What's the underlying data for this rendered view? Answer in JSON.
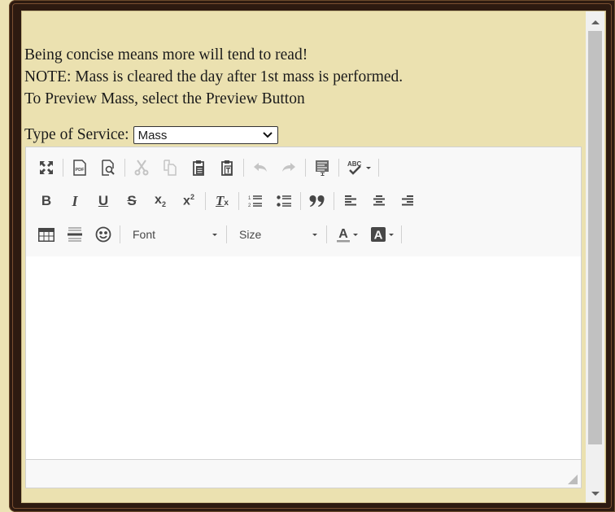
{
  "messages": [
    "Being concise means more will tend to read!",
    "NOTE: Mass is cleared the day after 1st mass is performed.",
    "To Preview Mass, select the Preview Button"
  ],
  "service": {
    "label": "Type of Service:",
    "selected": "Mass"
  },
  "toolbar": {
    "row1": [
      {
        "name": "maximize",
        "icon": "maximize-icon",
        "enabled": true
      },
      {
        "name": "export-pdf",
        "icon": "pdf-icon",
        "enabled": true
      },
      {
        "name": "preview",
        "icon": "preview-icon",
        "enabled": true
      },
      {
        "name": "cut",
        "icon": "scissors-icon",
        "enabled": false
      },
      {
        "name": "copy",
        "icon": "copy-icon",
        "enabled": false
      },
      {
        "name": "paste",
        "icon": "paste-icon",
        "enabled": true
      },
      {
        "name": "paste-text",
        "icon": "paste-text-icon",
        "enabled": true
      },
      {
        "name": "undo",
        "icon": "undo-icon",
        "enabled": false
      },
      {
        "name": "redo",
        "icon": "redo-icon",
        "enabled": false
      },
      {
        "name": "form-field",
        "icon": "text-field-icon",
        "enabled": true
      },
      {
        "name": "spell-check",
        "icon": "spellcheck-icon",
        "enabled": true
      }
    ],
    "row2": [
      {
        "name": "bold",
        "icon": "bold-icon",
        "enabled": true
      },
      {
        "name": "italic",
        "icon": "italic-icon",
        "enabled": true
      },
      {
        "name": "underline",
        "icon": "underline-icon",
        "enabled": true
      },
      {
        "name": "strikethrough",
        "icon": "strikethrough-icon",
        "enabled": true
      },
      {
        "name": "subscript",
        "icon": "subscript-icon",
        "enabled": true
      },
      {
        "name": "superscript",
        "icon": "superscript-icon",
        "enabled": true
      },
      {
        "name": "remove-format",
        "icon": "clear-format-icon",
        "enabled": true
      },
      {
        "name": "numbered-list",
        "icon": "numbered-list-icon",
        "enabled": true
      },
      {
        "name": "bulleted-list",
        "icon": "bulleted-list-icon",
        "enabled": true
      },
      {
        "name": "blockquote",
        "icon": "quote-icon",
        "enabled": true
      },
      {
        "name": "align-left",
        "icon": "align-left-icon",
        "enabled": true
      },
      {
        "name": "align-center",
        "icon": "align-center-icon",
        "enabled": true
      },
      {
        "name": "align-right",
        "icon": "align-right-icon",
        "enabled": true
      }
    ],
    "row3": [
      {
        "name": "table",
        "icon": "table-icon",
        "enabled": true
      },
      {
        "name": "horizontal-line",
        "icon": "horizontal-line-icon",
        "enabled": true
      },
      {
        "name": "smiley",
        "icon": "smiley-icon",
        "enabled": true
      }
    ],
    "font_label": "Font",
    "size_label": "Size"
  },
  "editor": {
    "content": ""
  }
}
